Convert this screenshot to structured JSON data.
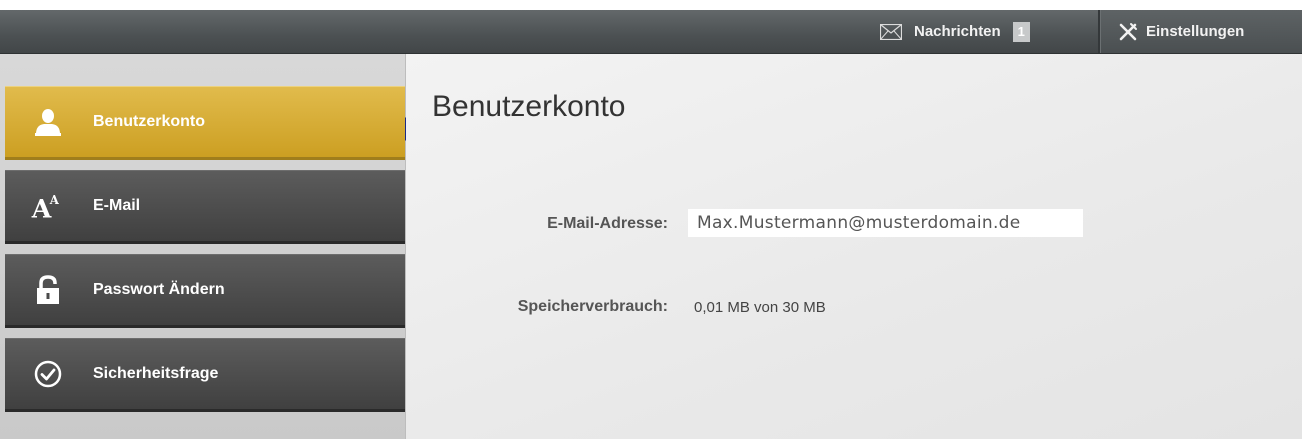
{
  "topbar": {
    "messages_label": "Nachrichten",
    "messages_count": "1",
    "settings_label": "Einstellungen"
  },
  "sidebar": {
    "items": [
      {
        "label": "Benutzerkonto",
        "icon": "user-icon",
        "active": true
      },
      {
        "label": "E-Mail",
        "icon": "font-size-icon",
        "active": false
      },
      {
        "label": "Passwort Ändern",
        "icon": "lock-icon",
        "active": false
      },
      {
        "label": "Sicherheitsfrage",
        "icon": "checkmark-circle-icon",
        "active": false
      }
    ]
  },
  "main": {
    "title": "Benutzerkonto",
    "email_label": "E-Mail-Adresse:",
    "email_value": "Max.Mustermann@musterdomain.de",
    "storage_label": "Speicherverbrauch:",
    "storage_value": "0,01 MB von 30 MB"
  },
  "colors": {
    "active_nav": "#d4aa30",
    "dark_nav": "#4a4a4a",
    "topbar": "#4c5153",
    "indicator_arrow": "#1b2a86"
  }
}
